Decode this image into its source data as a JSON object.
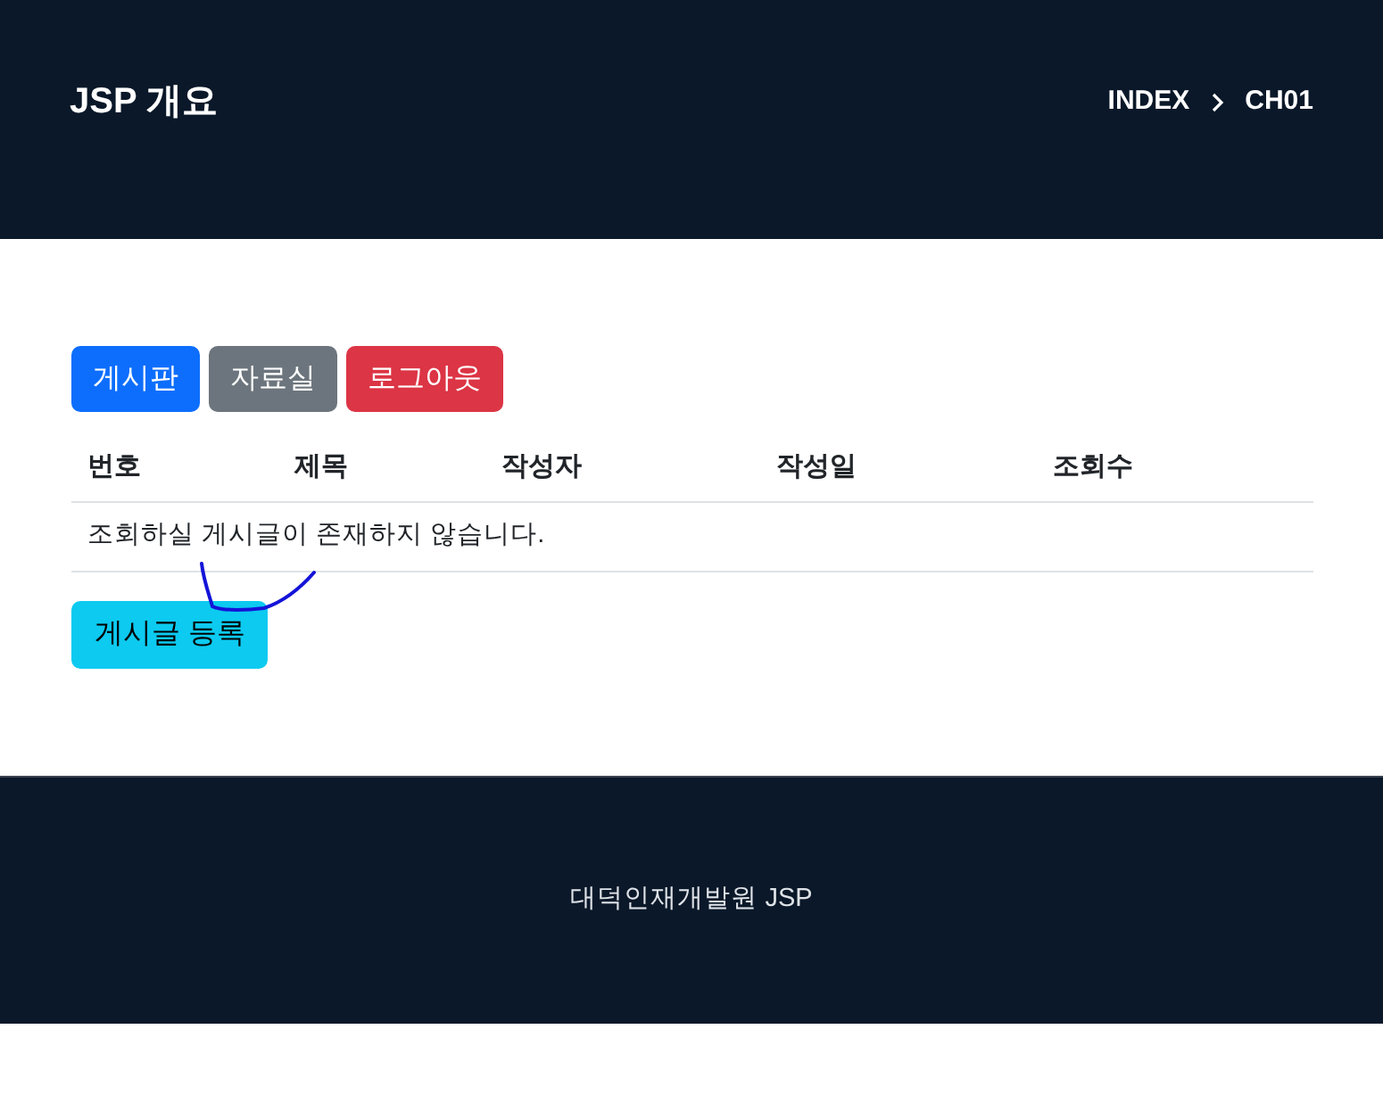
{
  "header": {
    "title": "JSP 개요",
    "breadcrumb": [
      {
        "label": "INDEX"
      },
      {
        "label": "CH01"
      }
    ]
  },
  "nav_buttons": [
    {
      "label": "게시판",
      "kind": "primary"
    },
    {
      "label": "자료실",
      "kind": "secondary"
    },
    {
      "label": "로그아웃",
      "kind": "danger"
    }
  ],
  "table": {
    "columns": [
      "번호",
      "제목",
      "작성자",
      "작성일",
      "조회수"
    ],
    "empty_message": "조회하실 게시글이 존재하지 않습니다."
  },
  "register_button": {
    "label": "게시글 등록",
    "kind": "info"
  },
  "footer": {
    "text": "대덕인재개발원 JSP"
  }
}
